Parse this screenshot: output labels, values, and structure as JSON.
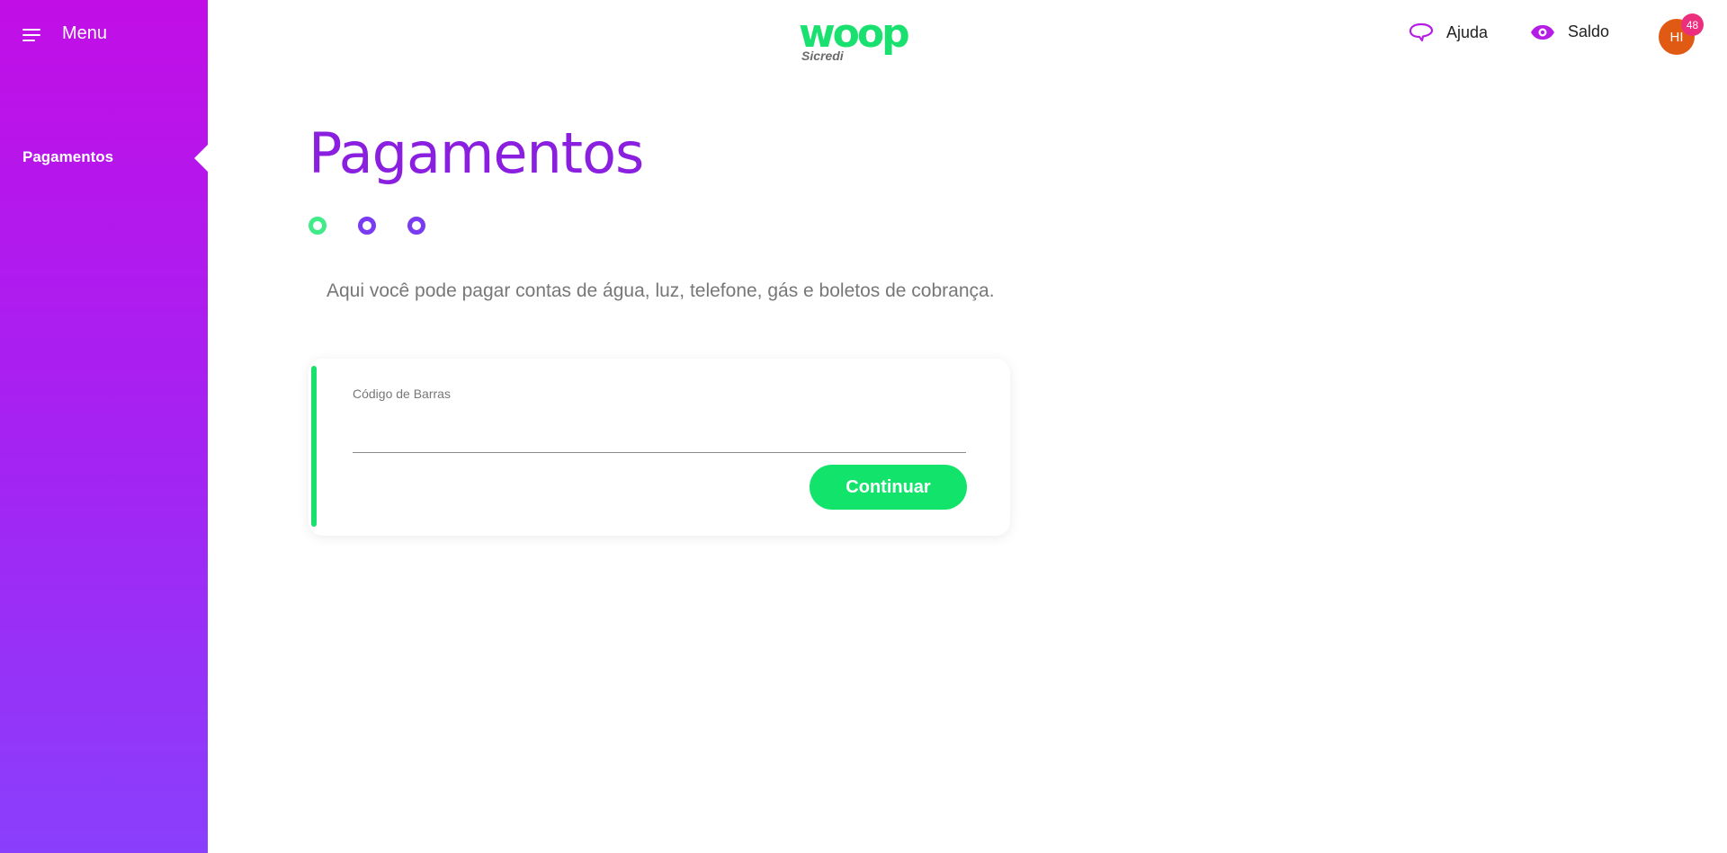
{
  "colors": {
    "sidebar_top": "#c10ee6",
    "sidebar_bottom": "#8a3ffc",
    "brand_green": "#19e06f",
    "title_purple": "#8a1fe0",
    "avatar": "#e05a14",
    "badge": "#ec2e7e"
  },
  "sidebar": {
    "menu_icon": "hamburger-icon",
    "menu_label": "Menu",
    "items": [
      {
        "label": "Pagamentos",
        "active": true
      }
    ]
  },
  "header": {
    "logo": {
      "text": "woop",
      "subtext": "Sicredi"
    },
    "help": {
      "icon": "speech-bubble-icon",
      "label": "Ajuda"
    },
    "balance": {
      "icon": "eye-icon",
      "label": "Saldo"
    },
    "user": {
      "initials": "HI",
      "notification_count": "48"
    }
  },
  "main": {
    "title": "Pagamentos",
    "steps": {
      "total": 3,
      "current": 1
    },
    "description": "Aqui você pode pagar contas de água, luz, telefone, gás e boletos de cobrança.",
    "form": {
      "barcode_label": "Código de Barras",
      "barcode_value": "",
      "submit_label": "Continuar"
    }
  }
}
